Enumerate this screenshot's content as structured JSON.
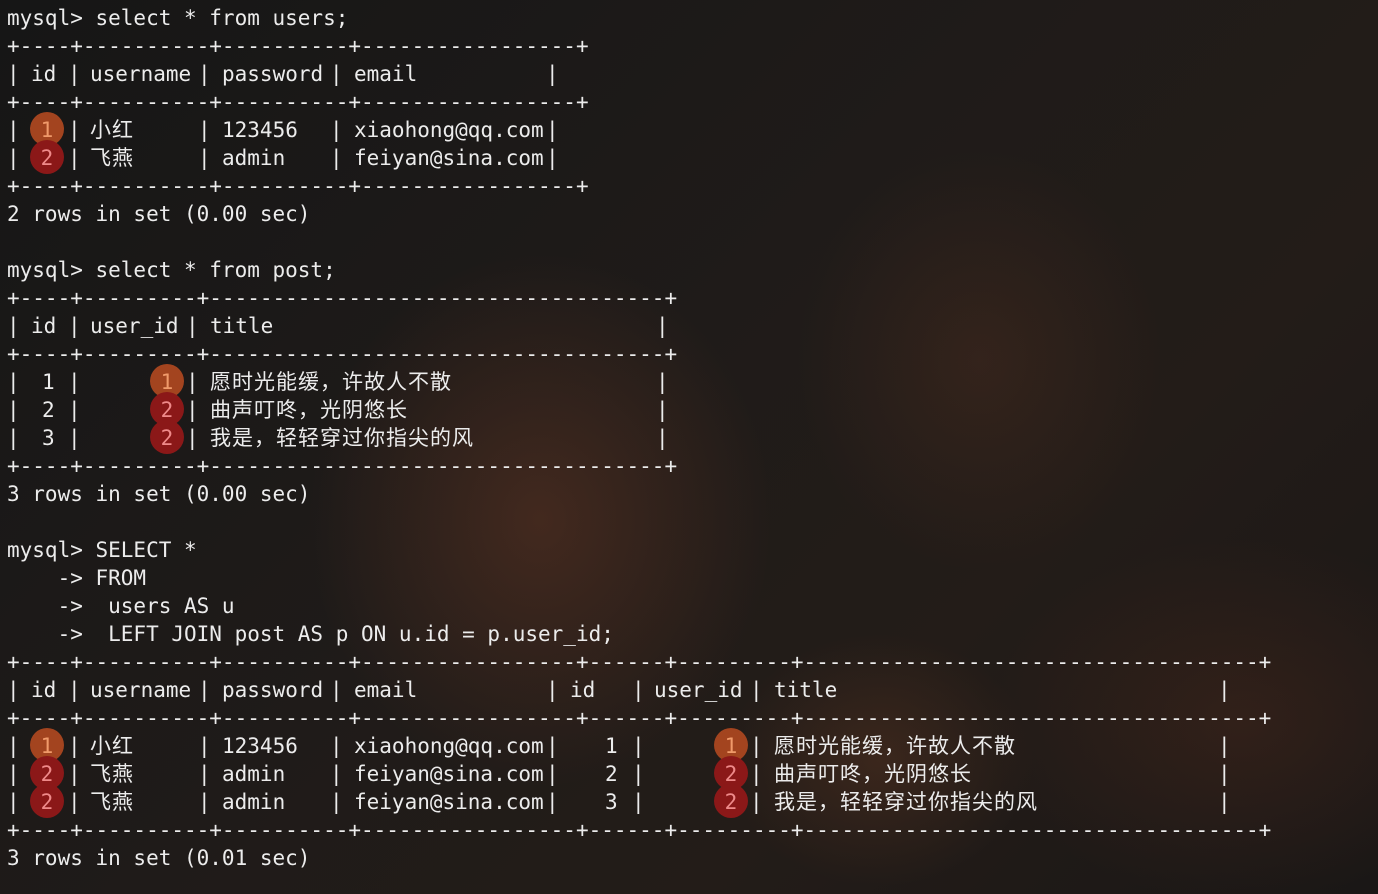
{
  "queries": {
    "q1": {
      "prompt": "mysql> select * from users;",
      "border": "+----+----------+----------+-----------------+",
      "header": {
        "id": "id",
        "username": "username",
        "password": "password",
        "email": "email"
      },
      "rows": [
        {
          "id": "1",
          "username": "小红",
          "password": "123456",
          "email": "xiaohong@qq.com"
        },
        {
          "id": "2",
          "username": "飞燕",
          "password": "admin",
          "email": "feiyan@sina.com"
        }
      ],
      "summary": "2 rows in set (0.00 sec)"
    },
    "q2": {
      "prompt": "mysql> select * from post;",
      "border": "+----+---------+------------------------------------+",
      "header": {
        "id": "id",
        "user_id": "user_id",
        "title": "title"
      },
      "rows": [
        {
          "id": "1",
          "user_id": "1",
          "title": "愿时光能缓，许故人不散"
        },
        {
          "id": "2",
          "user_id": "2",
          "title": "曲声叮咚，光阴悠长"
        },
        {
          "id": "3",
          "user_id": "2",
          "title": "我是，轻轻穿过你指尖的风"
        }
      ],
      "summary": "3 rows in set (0.00 sec)"
    },
    "q3": {
      "prompt_lines": [
        "mysql> SELECT *",
        "    -> FROM",
        "    ->  users AS u",
        "    ->  LEFT JOIN post AS p ON u.id = p.user_id;"
      ],
      "border": "+----+----------+----------+-----------------+------+---------+------------------------------------+",
      "header": {
        "id": "id",
        "username": "username",
        "password": "password",
        "email": "email",
        "id2": "id",
        "user_id": "user_id",
        "title": "title"
      },
      "rows": [
        {
          "id": "1",
          "username": "小红",
          "password": "123456",
          "email": "xiaohong@qq.com",
          "id2": "1",
          "user_id": "1",
          "title": "愿时光能缓，许故人不散"
        },
        {
          "id": "2",
          "username": "飞燕",
          "password": "admin",
          "email": "feiyan@sina.com",
          "id2": "2",
          "user_id": "2",
          "title": "曲声叮咚，光阴悠长"
        },
        {
          "id": "2",
          "username": "飞燕",
          "password": "admin",
          "email": "feiyan@sina.com",
          "id2": "3",
          "user_id": "2",
          "title": "我是，轻轻穿过你指尖的风"
        }
      ],
      "summary": "3 rows in set (0.01 sec)"
    }
  },
  "ui": {
    "pipe": "|",
    "badge_colors": {
      "one": "#a3441f",
      "two": "#8b1818"
    },
    "text_color": "#ececec"
  }
}
